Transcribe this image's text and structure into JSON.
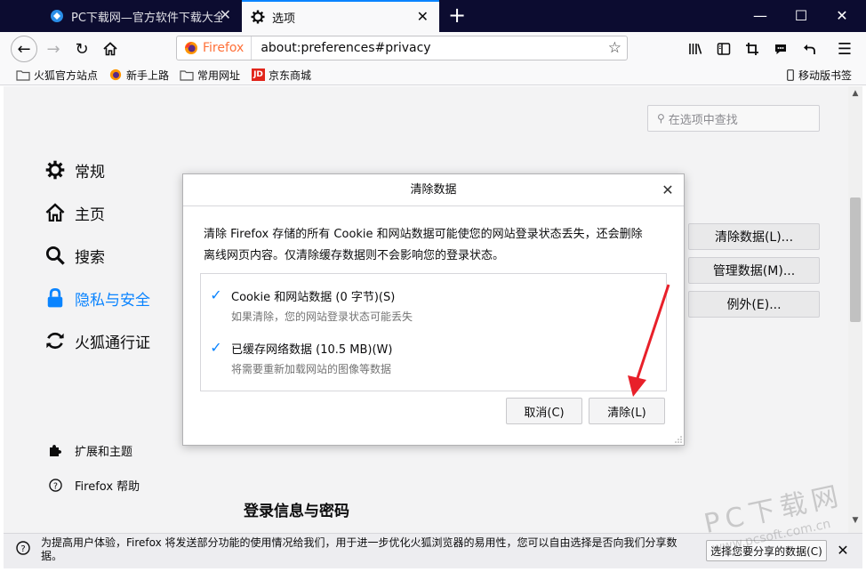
{
  "tabs": [
    {
      "title": "PC下载网—官方软件下载大全|",
      "active": false
    },
    {
      "title": "选项",
      "active": true
    }
  ],
  "urlbar": {
    "identity": "Firefox",
    "url": "about:preferences#privacy"
  },
  "bookmarks": [
    "火狐官方站点",
    "新手上路",
    "常用网址",
    "京东商城"
  ],
  "mobile_bookmarks": "移动版书签",
  "search": {
    "placeholder": "在选项中查找"
  },
  "categories": [
    {
      "label": "常规",
      "icon": "gear-icon"
    },
    {
      "label": "主页",
      "icon": "home-icon"
    },
    {
      "label": "搜索",
      "icon": "search-icon"
    },
    {
      "label": "隐私与安全",
      "icon": "lock-icon",
      "active": true
    },
    {
      "label": "火狐通行证",
      "icon": "sync-icon"
    }
  ],
  "footer_links": [
    "扩展和主题",
    "Firefox 帮助"
  ],
  "page_buttons": [
    "清除数据(L)...",
    "管理数据(M)...",
    "例外(E)..."
  ],
  "section_title": "登录信息与密码",
  "dialog": {
    "title": "清除数据",
    "desc_line1": "清除 Firefox 存储的所有 Cookie 和网站数据可能使您的网站登录状态丢失，还会删除",
    "desc_line2": "离线网页内容。仅清除缓存数据则不会影响您的登录状态。",
    "items": [
      {
        "label": "Cookie 和网站数据 (0 字节)(S)",
        "desc": "如果清除，您的网站登录状态可能丢失",
        "checked": true
      },
      {
        "label": "已缓存网络数据 (10.5 MB)(W)",
        "desc": "将需要重新加载网站的图像等数据",
        "checked": true
      }
    ],
    "cancel": "取消(C)",
    "clear": "清除(L)"
  },
  "notification": {
    "text": "为提高用户体验，Firefox 将发送部分功能的使用情况给我们，用于进一步优化火狐浏览器的易用性，您可以自由选择是否向我们分享数据。",
    "button": "选择您要分享的数据(C)"
  },
  "watermark": {
    "line1": "PC下载网",
    "line2": "www.pcsoft.com.cn"
  },
  "colors": {
    "accent": "#0a84ff",
    "tabbar": "#0c0c30",
    "arrow": "#e8202a"
  }
}
